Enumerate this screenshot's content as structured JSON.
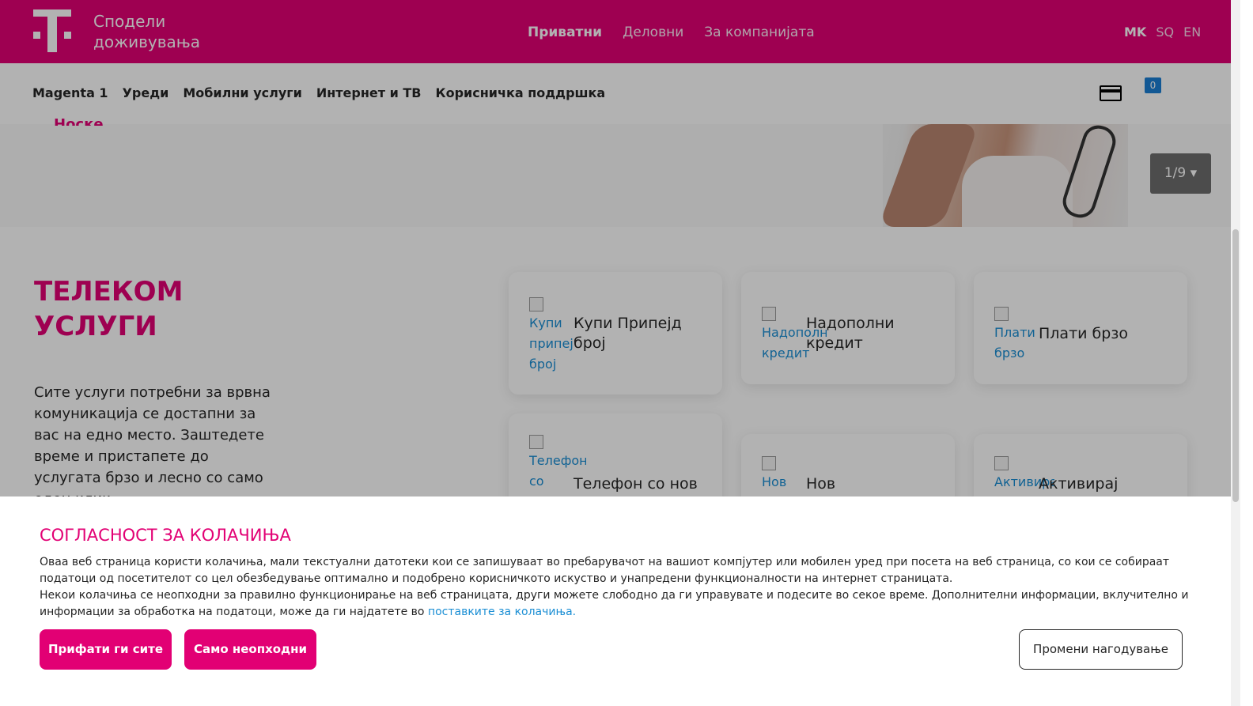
{
  "brand": {
    "tagline_line1": "Сподели",
    "tagline_line2": "доживувања",
    "color": "#e20074"
  },
  "main_nav": [
    {
      "label": "Приватни",
      "active": true
    },
    {
      "label": "Деловни",
      "active": false
    },
    {
      "label": "За компанијата",
      "active": false
    }
  ],
  "languages": [
    {
      "label": "MK",
      "active": true
    },
    {
      "label": "SQ",
      "active": false
    },
    {
      "label": "EN",
      "active": false
    }
  ],
  "sub_nav": [
    {
      "label": "Magenta 1"
    },
    {
      "label": "Уреди"
    },
    {
      "label": "Мобилни услуги"
    },
    {
      "label": "Интернет и ТВ"
    },
    {
      "label": "Корисничка поддршка"
    }
  ],
  "header_icons": {
    "payment_card_icon": "credit-card-icon",
    "cart_count": "0"
  },
  "hero": {
    "partial_text": "Носке",
    "slide_indicator": "1/9 ▾"
  },
  "services": {
    "title_line1": "ТЕЛЕКОМ",
    "title_line2": "УСЛУГИ",
    "description": "Сите услуги потребни за врвна комуникација се достапни за вас на едно место. Заштедете време и пристапете до услугата брзо и лесно со само еден клик.",
    "tiles": [
      {
        "alt": "Купи припејд број",
        "label": "Купи Припејд број"
      },
      {
        "alt": "Надополни кредит",
        "label": "Надополни кредит"
      },
      {
        "alt": "Плати брзо",
        "label": "Плати брзо"
      },
      {
        "alt": "Телефон со",
        "label": "Телефон со нов"
      },
      {
        "alt": "Нов",
        "label": "Нов"
      },
      {
        "alt": "Активирај",
        "label": "Активирај"
      }
    ]
  },
  "cookie_banner": {
    "title": "СОГЛАСНОСТ ЗА КОЛАЧИЊА",
    "text_part1": "Оваа веб страница користи колачиња, мали текстуални датотеки кои се запишуваат во пребарувачот на вашиот компјутер или мобилен уред при посета на веб страница, со кои се собираат податоци од посетителот со цел обезбедување оптимално и подобрено корисничкото искуство и унапредени функционалности на интернет страницата.",
    "text_part2": "Некои колачиња се неопходни за правилно функционирање на веб страницата, други можете слободно да ги управувате и подесите во секое време. Дополнителни информации, вклучително и информации за обработка на податоци, може да ги најдатете во ",
    "link_text": "поставките за колачиња.",
    "accept_all": "Прифати ги сите",
    "necessary_only": "Само неопходни",
    "customize": "Промени нагодување"
  }
}
